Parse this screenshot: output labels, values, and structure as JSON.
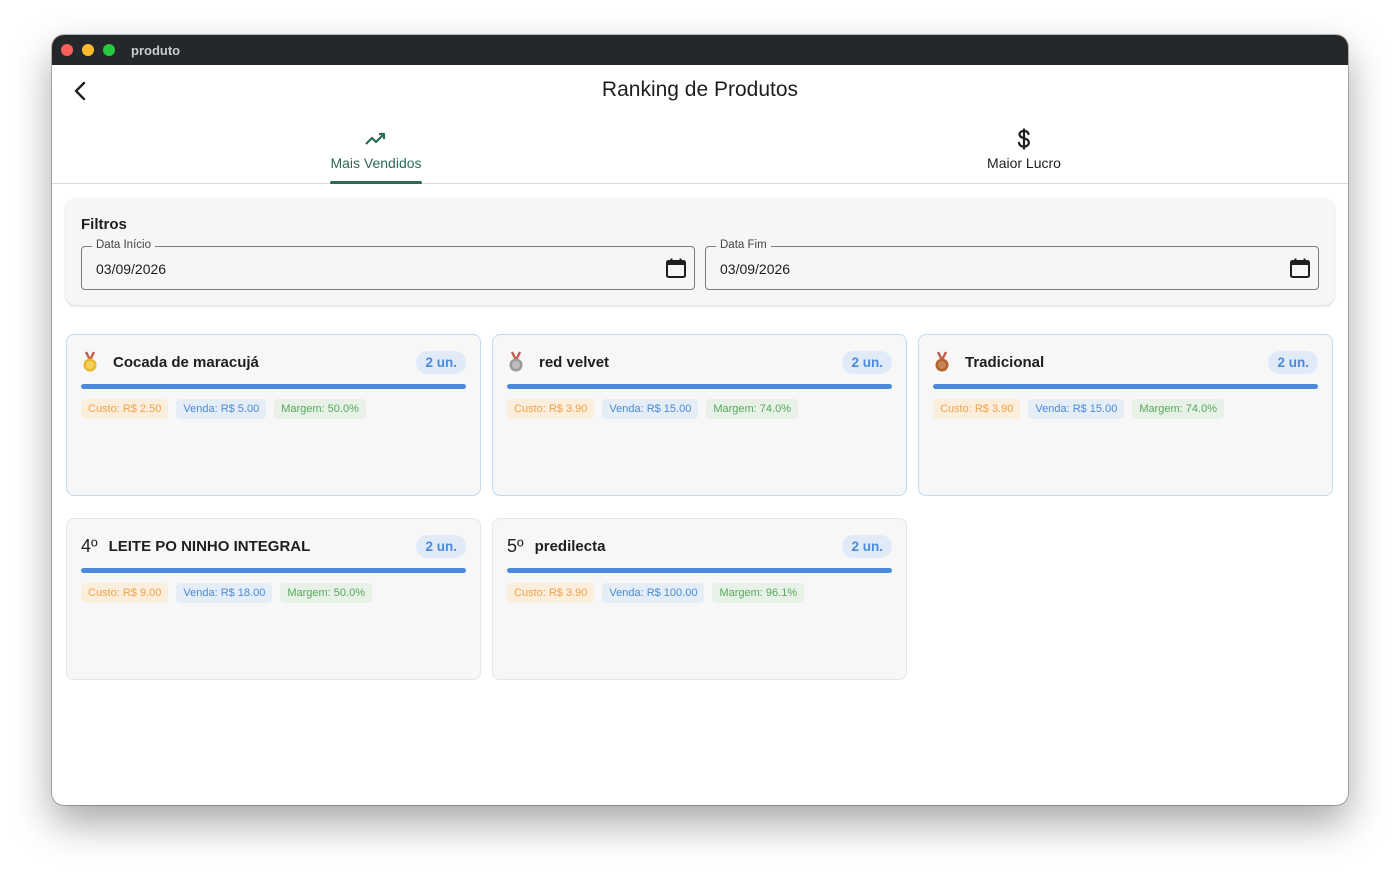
{
  "window": {
    "title": "produto"
  },
  "header": {
    "title": "Ranking de Produtos"
  },
  "tabs": [
    {
      "label": "Mais Vendidos",
      "icon": "trending-up-icon",
      "active": true
    },
    {
      "label": "Maior Lucro",
      "icon": "dollar-icon",
      "active": false
    }
  ],
  "filters": {
    "title": "Filtros",
    "start": {
      "label": "Data Início",
      "value": "03/09/2026"
    },
    "end": {
      "label": "Data Fim",
      "value": "03/09/2026"
    }
  },
  "colors": {
    "accent": "#2b6a58",
    "bar": "#4a8ad8",
    "gold": "#e8b830",
    "silver": "#9a9a9a",
    "bronze": "#b0652f"
  },
  "products": [
    {
      "rank": "1",
      "medal": "gold",
      "name": "Cocada de maracujá",
      "qty": "2 un.",
      "cost": "Custo: R$ 2.50",
      "sale": "Venda: R$ 5.00",
      "margin": "Margem: 50.0%"
    },
    {
      "rank": "2",
      "medal": "silver",
      "name": "red velvet",
      "qty": "2 un.",
      "cost": "Custo: R$ 3.90",
      "sale": "Venda: R$ 15.00",
      "margin": "Margem: 74.0%"
    },
    {
      "rank": "3",
      "medal": "bronze",
      "name": "Tradicional",
      "qty": "2 un.",
      "cost": "Custo: R$ 3.90",
      "sale": "Venda: R$ 15.00",
      "margin": "Margem: 74.0%"
    },
    {
      "rank": "4º",
      "medal": "",
      "name": "LEITE PO NINHO INTEGRAL",
      "qty": "2 un.",
      "cost": "Custo: R$ 9.00",
      "sale": "Venda: R$ 18.00",
      "margin": "Margem: 50.0%"
    },
    {
      "rank": "5º",
      "medal": "",
      "name": "predilecta",
      "qty": "2 un.",
      "cost": "Custo: R$ 3.90",
      "sale": "Venda: R$ 100.00",
      "margin": "Margem: 96.1%"
    }
  ]
}
